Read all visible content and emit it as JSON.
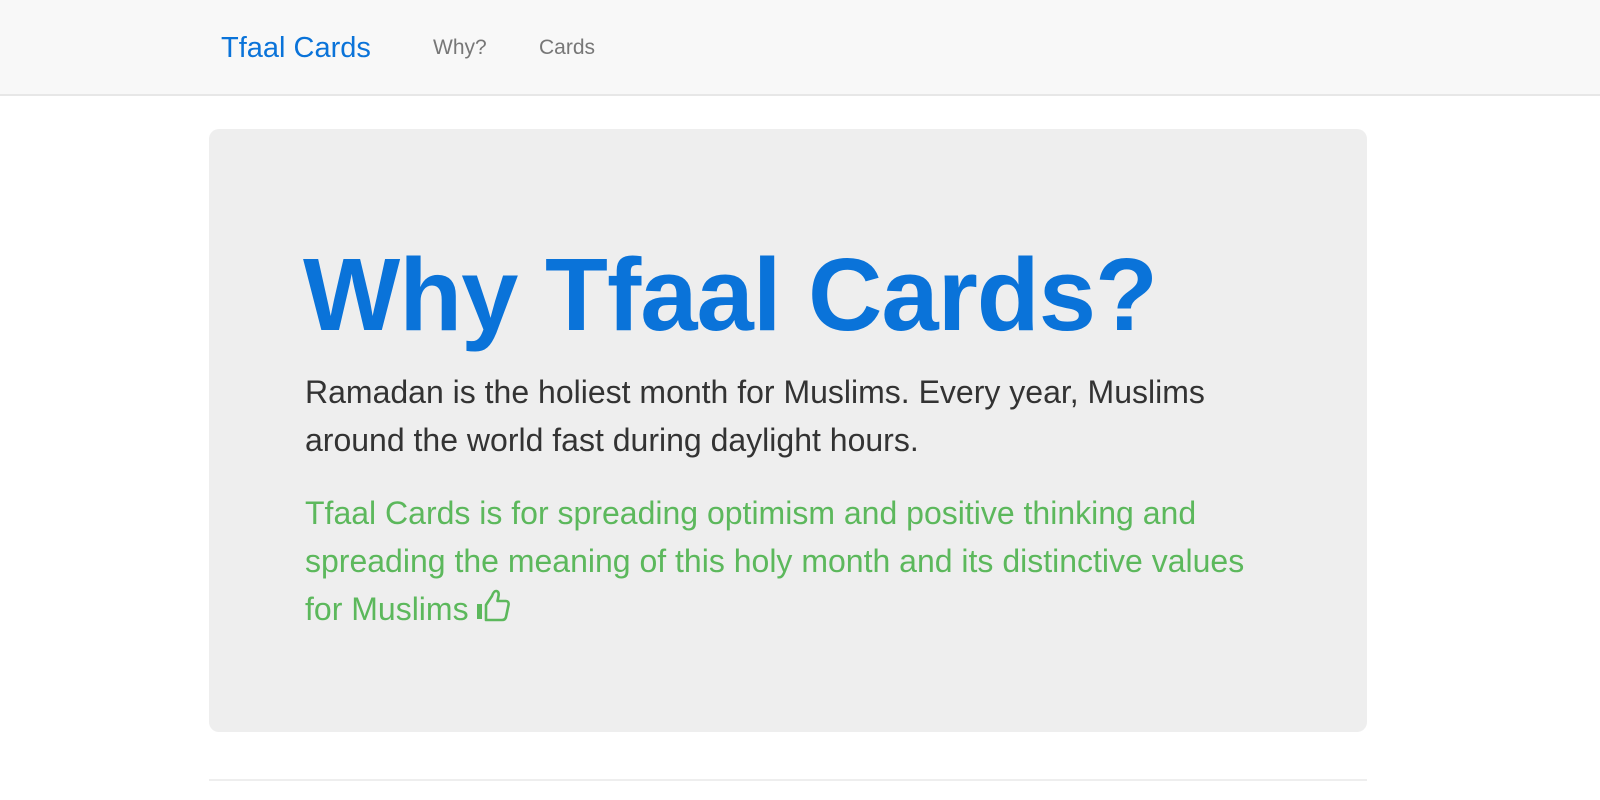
{
  "navbar": {
    "brand": "Tfaal Cards",
    "links": [
      {
        "label": "Why?"
      },
      {
        "label": "Cards"
      }
    ]
  },
  "jumbotron": {
    "title": "Why Tfaal Cards?",
    "lead": "Ramadan is the holiest month for Muslims. Every year, Muslims around the world fast during daylight hours.",
    "lead_green": "Tfaal Cards is for spreading optimism and positive thinking and spreading the meaning of this holy month and its distinctive values for Muslims",
    "lead_icon": "thumbs-up-icon"
  },
  "colors": {
    "brand": "#0a73d9",
    "success": "#5cb85c",
    "navbar_bg": "#f8f8f8",
    "jumbotron_bg": "#eeeeee"
  }
}
